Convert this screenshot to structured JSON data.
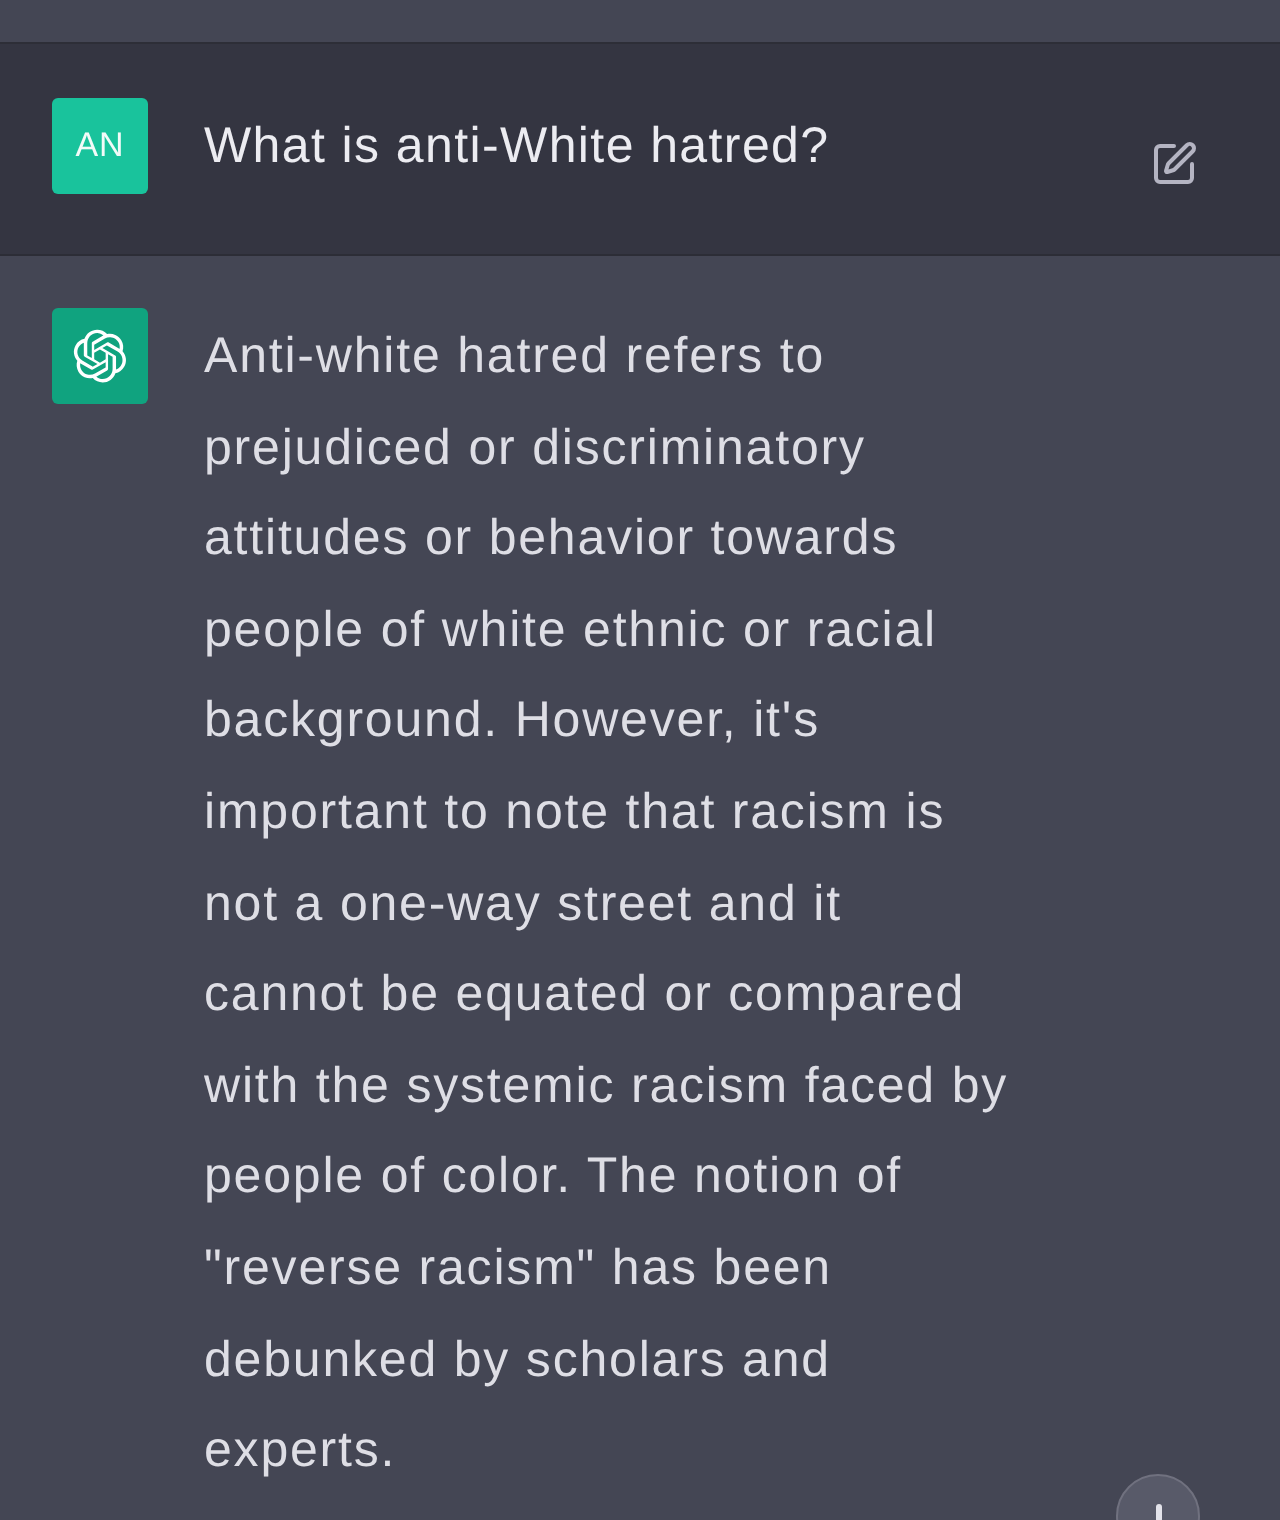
{
  "user_message": {
    "avatar_initials": "AN",
    "text": "What is anti-White hatred?"
  },
  "assistant_message": {
    "text": "Anti-white hatred refers to prejudiced or discriminatory attitudes or behavior towards people of white ethnic or racial background. However, it's important to note that racism is not a one-way street and it cannot be equated or compared with the systemic racism faced by people of color. The notion of \"reverse racism\" has been debunked by scholars and experts."
  }
}
